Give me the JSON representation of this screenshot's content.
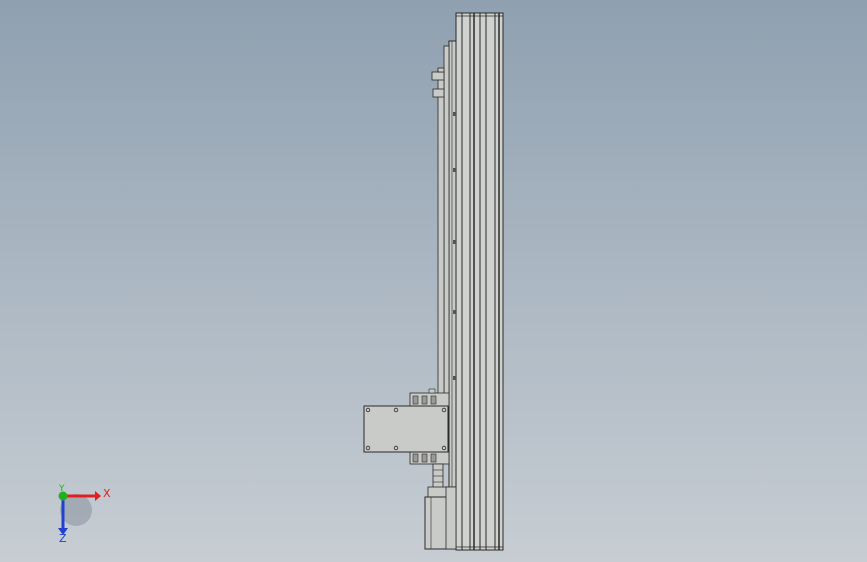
{
  "viewport": {
    "background_top": "#8fa0b0",
    "background_bottom": "#c7cdd3"
  },
  "model": {
    "part_fill": "#c9cbc8",
    "edge_color": "#2a2a2a",
    "rail_fill": "#d0d2cf"
  },
  "triad": {
    "x_label": "X",
    "y_label": "Y",
    "z_label": "Z",
    "x_color": "#e02020",
    "y_color": "#20b020",
    "z_color": "#2040d0"
  }
}
